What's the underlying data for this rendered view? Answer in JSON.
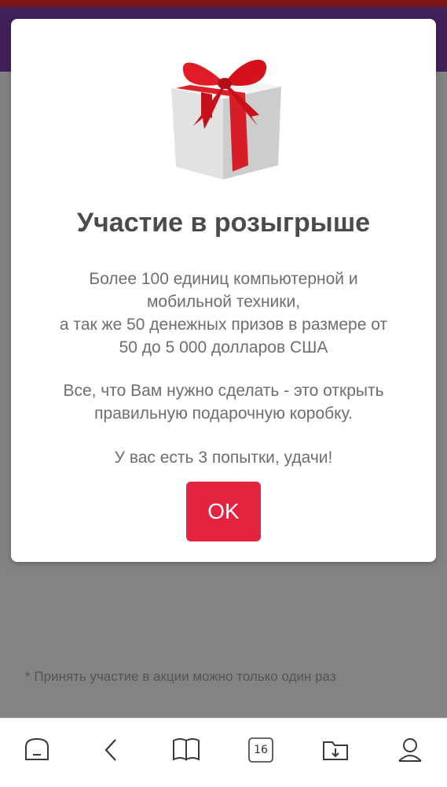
{
  "page": {
    "footnote": "* Принять участие в акции можно только один раз"
  },
  "modal": {
    "title": "Участие в розыгрыше",
    "prize_text_lines": [
      "Более 100 единиц компьютерной и",
      "мобильной техники,",
      "а так же 50 денежных призов в размере от",
      "50 до 5 000 долларов США"
    ],
    "instruction_lines": [
      "Все, что Вам нужно сделать - это открыть",
      "правильную подарочную коробку."
    ],
    "attempts_text": "У вас есть 3 попытки, удачи!",
    "ok_label": "OK",
    "gift_icon": "gift-box-red-ribbon"
  },
  "bottom_nav": {
    "tabs_count": "16",
    "items": [
      "home-icon",
      "back-icon",
      "bookmarks-icon",
      "tabs-icon",
      "downloads-icon",
      "profile-icon"
    ]
  },
  "colors": {
    "accent": "#e4233f",
    "banner": "#7a3ba6",
    "top_strip": "#e8262d"
  }
}
